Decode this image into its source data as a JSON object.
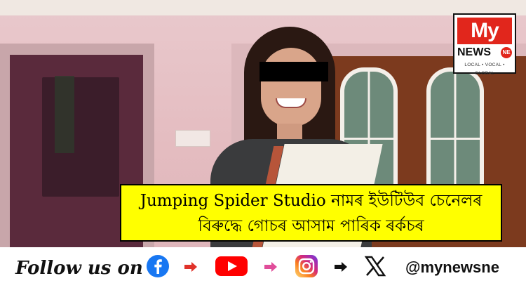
{
  "logo": {
    "my": "My",
    "news": "NEWS",
    "ne": "NE",
    "tagline": "LOCAL • VOCAL • GLOBAL"
  },
  "headline": {
    "line1": "Jumping Spider Studio নামৰ ইউটিউব চেনেলৰ",
    "line2": "বিৰুদ্ধে গোচৰ আসাম পাৰিক ৰৰ্কচৰ"
  },
  "footer": {
    "follow": "Follow us on",
    "handle": "@mynewsne"
  },
  "colors": {
    "headline_bg": "#ffff00",
    "logo_red": "#e1261c",
    "facebook": "#1877f2",
    "youtube": "#ff0000",
    "instagram": "#d62976",
    "arrow_red": "#e0322a",
    "arrow_pink": "#e04d9a"
  },
  "icons": [
    "facebook-icon",
    "youtube-icon",
    "instagram-icon",
    "x-icon"
  ]
}
